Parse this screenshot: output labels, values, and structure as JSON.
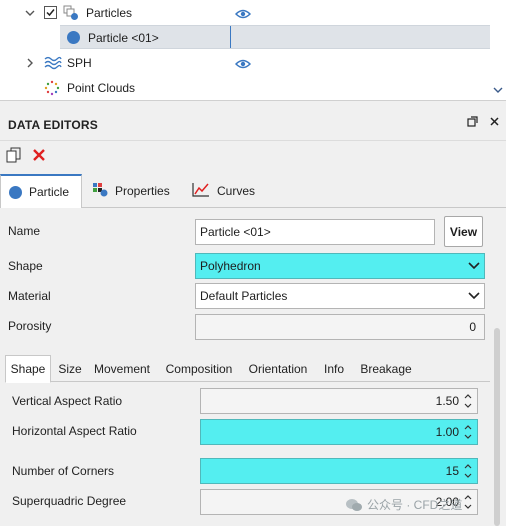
{
  "tree": {
    "rows": [
      {
        "label": "Particles",
        "expanded": true,
        "checked": true
      },
      {
        "label": "Particle <01>",
        "selected": true
      },
      {
        "label": "SPH",
        "expanded": false
      },
      {
        "label": "Point Clouds"
      }
    ]
  },
  "panel": {
    "title": "DATA EDITORS"
  },
  "main_tabs": [
    {
      "label": "Particle",
      "active": true
    },
    {
      "label": "Properties"
    },
    {
      "label": "Curves"
    }
  ],
  "form": {
    "name": {
      "label": "Name",
      "value": "Particle <01>",
      "view_label": "View"
    },
    "shape": {
      "label": "Shape",
      "value": "Polyhedron"
    },
    "material": {
      "label": "Material",
      "value": "Default Particles"
    },
    "porosity": {
      "label": "Porosity",
      "value": "0"
    }
  },
  "sub_tabs": [
    {
      "label": "Shape",
      "active": true
    },
    {
      "label": "Size"
    },
    {
      "label": "Movement"
    },
    {
      "label": "Composition"
    },
    {
      "label": "Orientation"
    },
    {
      "label": "Info"
    },
    {
      "label": "Breakage"
    }
  ],
  "shape_fields": {
    "vertical_aspect": {
      "label": "Vertical Aspect Ratio",
      "value": "1.50"
    },
    "horizontal_aspect": {
      "label": "Horizontal Aspect Ratio",
      "value": "1.00"
    },
    "corners": {
      "label": "Number of Corners",
      "value": "15"
    },
    "superquadric": {
      "label": "Superquadric Degree",
      "value": "2.00"
    }
  },
  "watermark": {
    "text": "公众号 · CFD之道"
  },
  "colors": {
    "accent": "#3a78c2",
    "highlight": "#54eef0",
    "delete": "#e02020"
  }
}
